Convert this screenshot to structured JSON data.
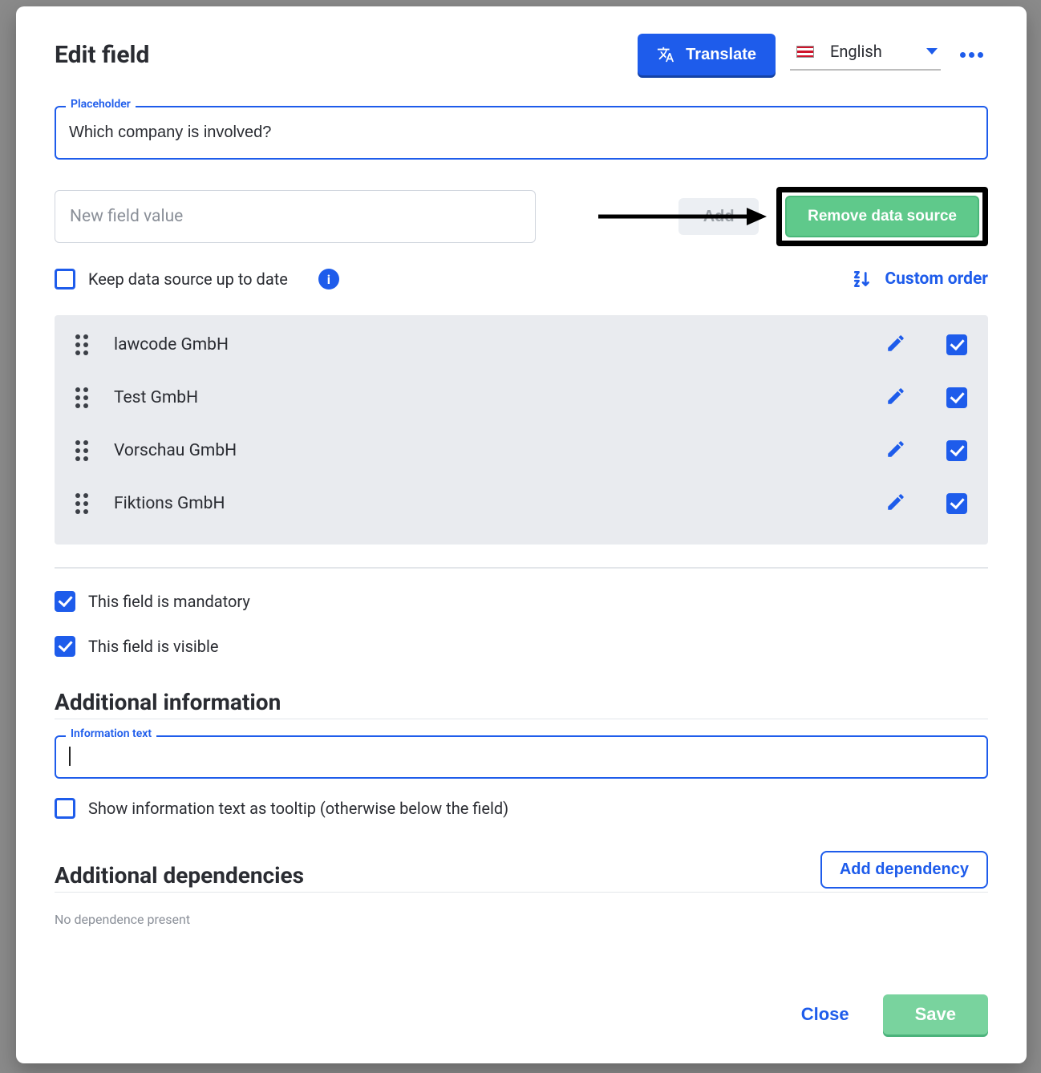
{
  "header": {
    "title": "Edit field",
    "translate_label": "Translate",
    "language_name": "English"
  },
  "placeholder": {
    "label": "Placeholder",
    "value": "Which company is involved?"
  },
  "newvalue": {
    "placeholder": "New field value",
    "add_label": "Add",
    "remove_label": "Remove data source"
  },
  "keepuptodate": {
    "label": "Keep data source up to date",
    "checked": false
  },
  "custom_order_label": "Custom order",
  "values": [
    {
      "name": "lawcode GmbH",
      "checked": true
    },
    {
      "name": "Test GmbH",
      "checked": true
    },
    {
      "name": "Vorschau GmbH",
      "checked": true
    },
    {
      "name": "Fiktions GmbH",
      "checked": true
    }
  ],
  "flags": {
    "mandatory_label": "This field is mandatory",
    "mandatory_checked": true,
    "visible_label": "This field is visible",
    "visible_checked": true
  },
  "additional_info": {
    "title": "Additional information",
    "legend": "Information text",
    "value": "",
    "tooltip_label": "Show information text as tooltip (otherwise below the field)",
    "tooltip_checked": false
  },
  "dependencies": {
    "title": "Additional dependencies",
    "add_label": "Add dependency",
    "empty_label": "No dependence present"
  },
  "footer": {
    "close_label": "Close",
    "save_label": "Save"
  }
}
